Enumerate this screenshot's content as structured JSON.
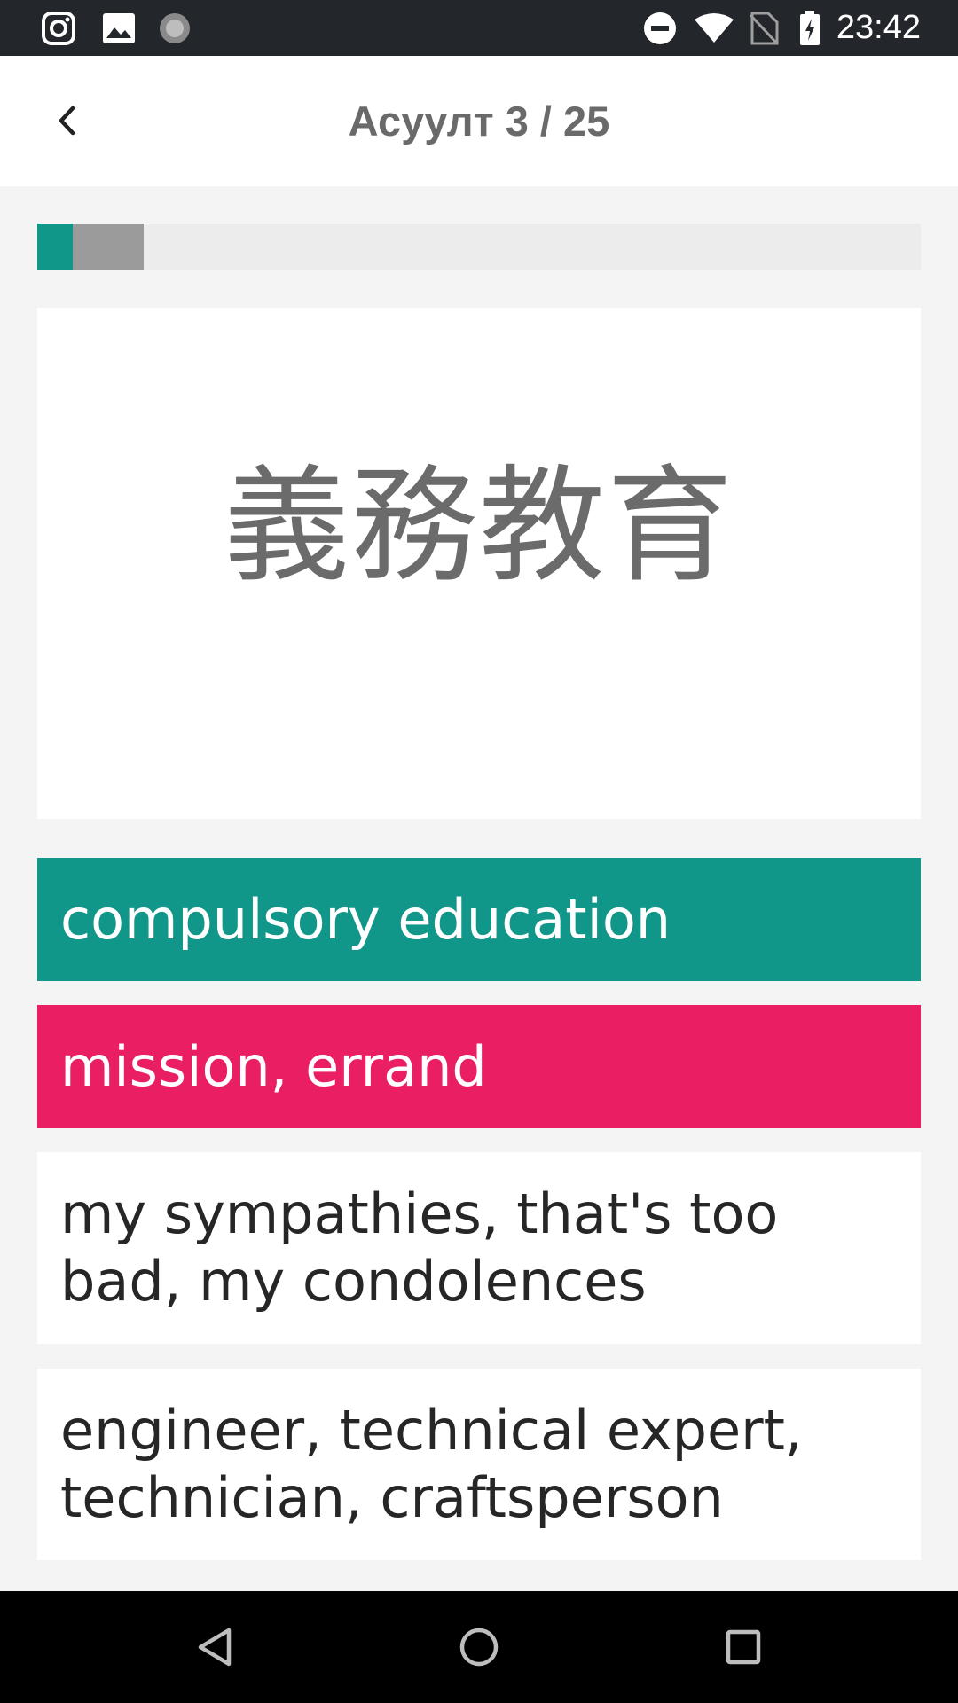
{
  "status_bar": {
    "time": "23:42",
    "left_icons": [
      "instagram-icon",
      "image-icon",
      "loading-icon"
    ],
    "right_icons": [
      "do-not-disturb-icon",
      "wifi-icon",
      "no-sim-icon",
      "battery-charging-icon"
    ]
  },
  "header": {
    "title": "Асуулт 3 / 25",
    "back_icon": "chevron-left-icon"
  },
  "progress": {
    "correct_fraction": 0.04,
    "wrong_fraction": 0.08,
    "colors": {
      "correct": "#11968a",
      "wrong": "#9b9b9b",
      "track": "#ececec"
    }
  },
  "question": {
    "kanji": "義務教育"
  },
  "options": [
    {
      "label": "compulsory education",
      "state": "correct"
    },
    {
      "label": "mission, errand",
      "state": "wrong"
    },
    {
      "label": "my sympathies, that's too bad, my condolences",
      "state": "neutral"
    },
    {
      "label": "engineer, technical expert, technician, craftsperson",
      "state": "neutral"
    }
  ],
  "colors": {
    "correct": "#11968a",
    "wrong": "#e91e63",
    "title_gray": "#6a6a6a"
  },
  "nav_bar": {
    "buttons": [
      "back-triangle-icon",
      "home-circle-icon",
      "recents-square-icon"
    ]
  }
}
